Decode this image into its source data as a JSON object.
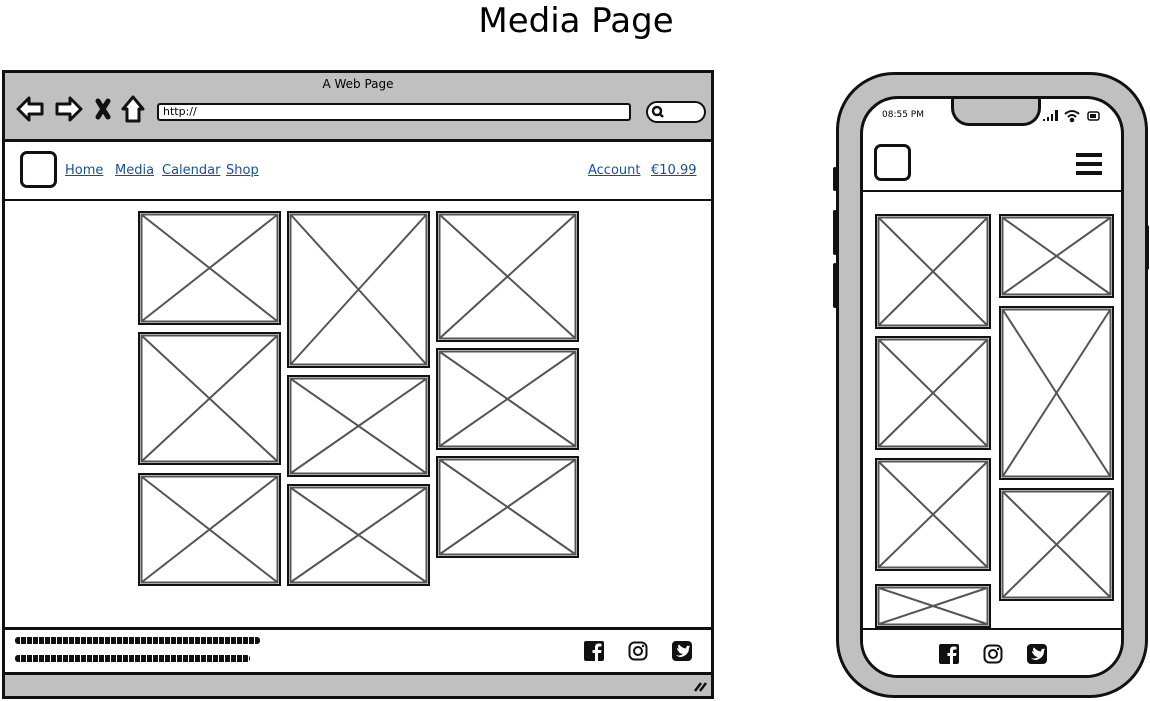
{
  "title": "Media Page",
  "browser": {
    "window_title": "A Web Page",
    "url": "http://",
    "nav": {
      "links": [
        "Home",
        "Media",
        "Calendar",
        "Shop"
      ],
      "account": "Account",
      "price": "€10.99"
    },
    "footer": {
      "social_icons": [
        "facebook-icon",
        "instagram-icon",
        "twitter-icon"
      ]
    },
    "image_placeholder_count": 9
  },
  "phone": {
    "time": "08:55 PM",
    "status_icons": [
      "signal-icon",
      "wifi-icon",
      "battery-icon"
    ],
    "menu_icon": "hamburger-icon",
    "image_placeholder_count": 7,
    "footer": {
      "social_icons": [
        "facebook-icon",
        "instagram-icon",
        "twitter-icon"
      ]
    }
  },
  "colors": {
    "frame": "#c0c0c0",
    "link": "#1a4f8f",
    "placeholder_stroke": "#555555"
  }
}
